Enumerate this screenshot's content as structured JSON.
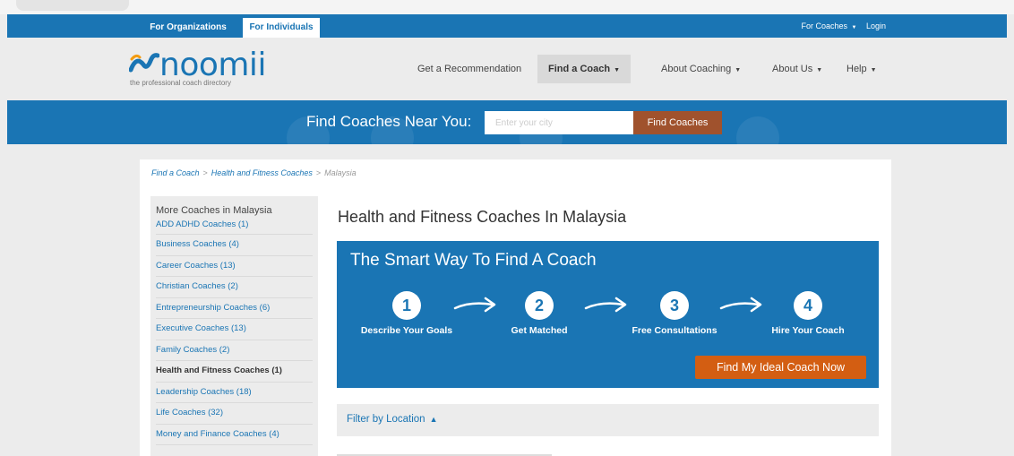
{
  "topbar": {
    "tab_organizations": "For Organizations",
    "tab_individuals": "For Individuals",
    "for_coaches": "For Coaches",
    "login": "Login"
  },
  "header": {
    "logo_text": "noomii",
    "tagline": "the professional coach directory",
    "nav": {
      "recommendation": "Get a Recommendation",
      "find_coach": "Find a Coach",
      "about_coaching": "About Coaching",
      "about_us": "About Us",
      "help": "Help"
    }
  },
  "hero": {
    "label": "Find Coaches Near You:",
    "input_placeholder": "Enter your city",
    "button": "Find Coaches"
  },
  "breadcrumb": {
    "item1": "Find a Coach",
    "item2": "Health and Fitness Coaches",
    "current": "Malaysia",
    "separator": ">"
  },
  "sidebar": {
    "title": "More Coaches in Malaysia",
    "items": [
      "ADD ADHD Coaches (1)",
      "Business Coaches (4)",
      "Career Coaches (13)",
      "Christian Coaches (2)",
      "Entrepreneurship Coaches (6)",
      "Executive Coaches (13)",
      "Family Coaches (2)",
      "Health and Fitness Coaches (1)",
      "Leadership Coaches (18)",
      "Life Coaches (32)",
      "Money and Finance Coaches (4)"
    ]
  },
  "main": {
    "title": "Health and Fitness Coaches In Malaysia",
    "smart": {
      "title": "The Smart Way To Find A Coach",
      "steps": [
        {
          "num": "1",
          "label": "Describe Your Goals"
        },
        {
          "num": "2",
          "label": "Get Matched"
        },
        {
          "num": "3",
          "label": "Free Consultations"
        },
        {
          "num": "4",
          "label": "Hire Your Coach"
        }
      ],
      "button": "Find My Ideal Coach Now"
    },
    "filter": {
      "label": "Filter by Location",
      "toggle": "▲"
    }
  },
  "colors": {
    "brand_blue": "#1a75b4",
    "search_button": "#a0522d",
    "cta_orange": "#d35e12",
    "panel_gray": "#ececec"
  }
}
